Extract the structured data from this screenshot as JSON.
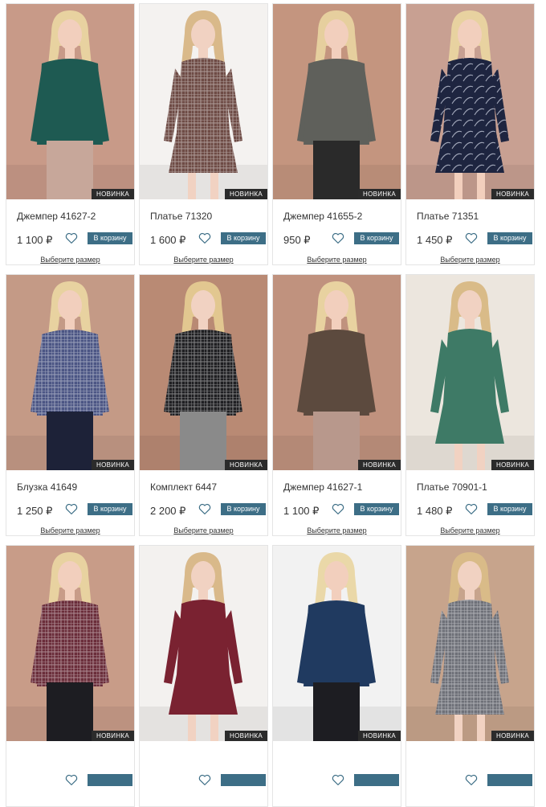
{
  "products": [
    {
      "name": "Джемпер 41627-2",
      "price": "1 100 ₽",
      "badge": "НОВИНКА",
      "cart_label": "В корзину",
      "size_label": "Выберите размер",
      "bg": "#c89a88",
      "garment": "#1e5a52",
      "skin": "#f2cfbd",
      "hair": "#e8d2a0",
      "bottom": "#c7a79a",
      "pattern": "solid"
    },
    {
      "name": "Платье 71320",
      "price": "1 600 ₽",
      "badge": "НОВИНКА",
      "cart_label": "В корзину",
      "size_label": "Выберите размер",
      "bg": "#f4f2f0",
      "garment": "#6e4b45",
      "skin": "#f1d2c2",
      "hair": "#d9b98a",
      "bottom": "#6e4b45",
      "pattern": "check"
    },
    {
      "name": "Джемпер 41655-2",
      "price": "950 ₽",
      "badge": "НОВИНКА",
      "cart_label": "В корзину",
      "size_label": "Выберите размер",
      "bg": "#c4957f",
      "garment": "#5f605b",
      "skin": "#f2cfbd",
      "hair": "#e6cf9e",
      "bottom": "#2a2a2a",
      "pattern": "solid"
    },
    {
      "name": "Платье 71351",
      "price": "1 450 ₽",
      "badge": "НОВИНКА",
      "cart_label": "В корзину",
      "size_label": "Выберите размер",
      "bg": "#c8a092",
      "garment": "#1e2540",
      "skin": "#f2cfbd",
      "hair": "#e8d2a0",
      "bottom": "#1e2540",
      "pattern": "leaf"
    },
    {
      "name": "Блузка 41649",
      "price": "1 250 ₽",
      "badge": "НОВИНКА",
      "cart_label": "В корзину",
      "size_label": "Выберите размер",
      "bg": "#c49a86",
      "garment": "#4b5584",
      "skin": "#f2cfbd",
      "hair": "#e8d2a0",
      "bottom": "#1d2238",
      "pattern": "check"
    },
    {
      "name": "Комплект 6447",
      "price": "2 200 ₽",
      "badge": "НОВИНКА",
      "cart_label": "В корзину",
      "size_label": "Выберите размер",
      "bg": "#b98a74",
      "garment": "#1f1f22",
      "skin": "#f1d2c2",
      "hair": "#e2c790",
      "bottom": "#8a8a8a",
      "pattern": "check"
    },
    {
      "name": "Джемпер 41627-1",
      "price": "1 100 ₽",
      "badge": "НОВИНКА",
      "cart_label": "В корзину",
      "size_label": "Выберите размер",
      "bg": "#c0927e",
      "garment": "#5c4a3e",
      "skin": "#f2cfbd",
      "hair": "#e8d2a0",
      "bottom": "#b8988c",
      "pattern": "solid"
    },
    {
      "name": "Платье 70901-1",
      "price": "1 480 ₽",
      "badge": "НОВИНКА",
      "cart_label": "В корзину",
      "size_label": "Выберите размер",
      "bg": "#ece6de",
      "garment": "#3e7a66",
      "skin": "#f1d2c2",
      "hair": "#d9bb88",
      "bottom": "#3e7a66",
      "pattern": "solid"
    },
    {
      "name": "",
      "price": "",
      "badge": "НОВИНКА",
      "cart_label": "",
      "size_label": "",
      "bg": "#c89c88",
      "garment": "#6a2d3a",
      "skin": "#f2cfbd",
      "hair": "#e8d2a0",
      "bottom": "#1d1d22",
      "pattern": "check"
    },
    {
      "name": "",
      "price": "",
      "badge": "НОВИНКА",
      "cart_label": "",
      "size_label": "",
      "bg": "#f3f1ef",
      "garment": "#7a2231",
      "skin": "#f1d2c2",
      "hair": "#d9b98a",
      "bottom": "#7a2231",
      "pattern": "solid"
    },
    {
      "name": "",
      "price": "",
      "badge": "НОВИНКА",
      "cart_label": "",
      "size_label": "",
      "bg": "#f2f2f2",
      "garment": "#203a60",
      "skin": "#f2cfbd",
      "hair": "#ead8a8",
      "bottom": "#1d1d22",
      "pattern": "solid"
    },
    {
      "name": "",
      "price": "",
      "badge": "НОВИНКА",
      "cart_label": "",
      "size_label": "",
      "bg": "#c7a48c",
      "garment": "#6e7078",
      "skin": "#f1d2c2",
      "hair": "#d9bb88",
      "bottom": "#6e7078",
      "pattern": "check"
    }
  ]
}
